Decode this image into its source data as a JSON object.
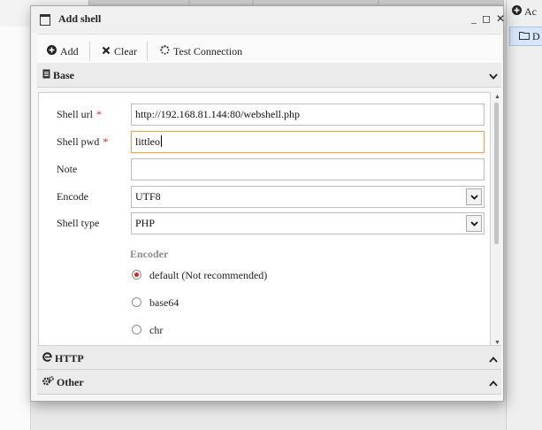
{
  "dialog": {
    "title": "Add shell",
    "window_buttons": {
      "minimize": "_",
      "maximize": "◻",
      "close": "✕"
    }
  },
  "toolbar": {
    "add_label": "Add",
    "clear_label": "Clear",
    "test_label": "Test Connection"
  },
  "sections": {
    "base": "Base",
    "http": "HTTP",
    "other": "Other"
  },
  "form": {
    "shell_url": {
      "label": "Shell url",
      "value": "http://192.168.81.144:80/webshell.php",
      "required": "*"
    },
    "shell_pwd": {
      "label": "Shell pwd",
      "value": "littleo",
      "required": "*"
    },
    "note": {
      "label": "Note",
      "value": ""
    },
    "encode": {
      "label": "Encode",
      "value": "UTF8"
    },
    "shell_type": {
      "label": "Shell type",
      "value": "PHP"
    },
    "encoder": {
      "title": "Encoder",
      "options": [
        "default (Not recommended)",
        "base64",
        "chr"
      ],
      "selected": "default (Not recommended)"
    }
  },
  "background": {
    "right_panel": {
      "row1": "Ac",
      "row2": "D"
    }
  },
  "colors": {
    "required": "#d9261c",
    "focus_border": "#e3a95a",
    "selected_row": "#d7e6f8"
  }
}
